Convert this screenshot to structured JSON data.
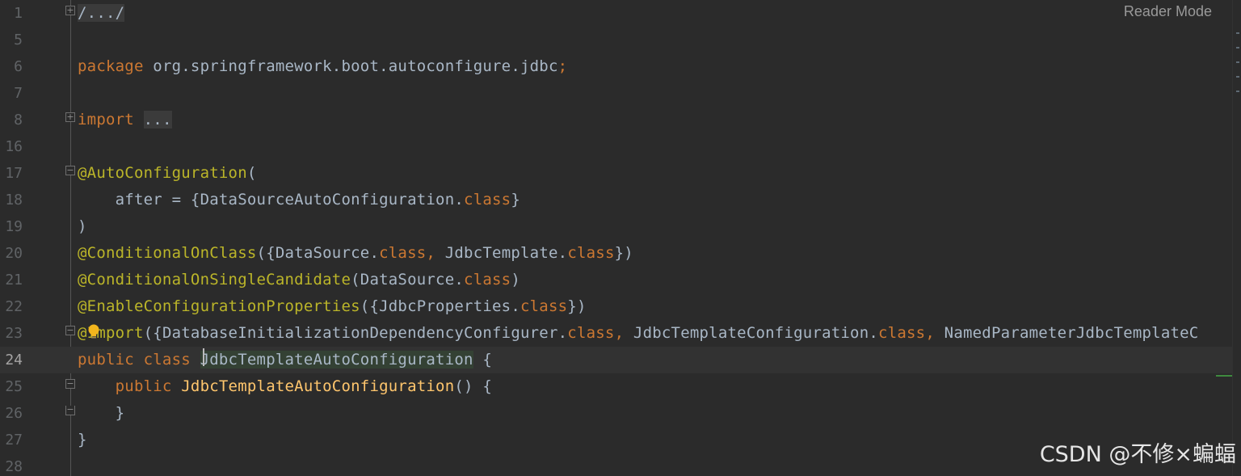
{
  "reader_mode_label": "Reader Mode",
  "watermark": "CSDN @不修×蝙蝠",
  "lines": [
    {
      "num": "1",
      "segments": [
        {
          "t": "/.../",
          "c": "collapsed"
        }
      ]
    },
    {
      "num": "5",
      "segments": []
    },
    {
      "num": "6",
      "segments": [
        {
          "t": "package",
          "c": "kw"
        },
        {
          "t": " org.springframework.boot.autoconfigure.jdbc",
          "c": ""
        },
        {
          "t": ";",
          "c": "kw"
        }
      ]
    },
    {
      "num": "7",
      "segments": []
    },
    {
      "num": "8",
      "segments": [
        {
          "t": "import",
          "c": "kw"
        },
        {
          "t": " ",
          "c": ""
        },
        {
          "t": "...",
          "c": "collapsed"
        }
      ]
    },
    {
      "num": "16",
      "segments": []
    },
    {
      "num": "17",
      "segments": [
        {
          "t": "@AutoConfiguration",
          "c": "ann"
        },
        {
          "t": "(",
          "c": ""
        }
      ]
    },
    {
      "num": "18",
      "segments": [
        {
          "t": "    after = {DataSourceAutoConfiguration.",
          "c": ""
        },
        {
          "t": "class",
          "c": "kw"
        },
        {
          "t": "}",
          "c": ""
        }
      ]
    },
    {
      "num": "19",
      "segments": [
        {
          "t": ")",
          "c": ""
        }
      ]
    },
    {
      "num": "20",
      "segments": [
        {
          "t": "@ConditionalOnClass",
          "c": "ann"
        },
        {
          "t": "({DataSource.",
          "c": ""
        },
        {
          "t": "class, ",
          "c": "kw"
        },
        {
          "t": "JdbcTemplate.",
          "c": ""
        },
        {
          "t": "class",
          "c": "kw"
        },
        {
          "t": "})",
          "c": ""
        }
      ]
    },
    {
      "num": "21",
      "segments": [
        {
          "t": "@ConditionalOnSingleCandidate",
          "c": "ann"
        },
        {
          "t": "(DataSource.",
          "c": ""
        },
        {
          "t": "class",
          "c": "kw"
        },
        {
          "t": ")",
          "c": ""
        }
      ]
    },
    {
      "num": "22",
      "segments": [
        {
          "t": "@EnableConfigurationProperties",
          "c": "ann"
        },
        {
          "t": "({JdbcProperties.",
          "c": ""
        },
        {
          "t": "class",
          "c": "kw"
        },
        {
          "t": "})",
          "c": ""
        }
      ]
    },
    {
      "num": "23",
      "segments": [
        {
          "t": "@Import",
          "c": "ann"
        },
        {
          "t": "({DatabaseInitializationDependencyConfigurer.",
          "c": ""
        },
        {
          "t": "class, ",
          "c": "kw"
        },
        {
          "t": "JdbcTemplateConfiguration.",
          "c": ""
        },
        {
          "t": "class, ",
          "c": "kw"
        },
        {
          "t": "NamedParameterJdbcTemplateC",
          "c": ""
        }
      ]
    },
    {
      "num": "24",
      "current": true,
      "segments": [
        {
          "t": "public class ",
          "c": "kw"
        },
        {
          "t": "JdbcTemplateAutoConfiguration",
          "c": "sel-word"
        },
        {
          "t": " {",
          "c": ""
        }
      ]
    },
    {
      "num": "25",
      "segments": [
        {
          "t": "    ",
          "c": ""
        },
        {
          "t": "public ",
          "c": "kw"
        },
        {
          "t": "JdbcTemplateAutoConfiguration",
          "c": "fn"
        },
        {
          "t": "() {",
          "c": ""
        }
      ]
    },
    {
      "num": "26",
      "segments": [
        {
          "t": "    }",
          "c": ""
        }
      ]
    },
    {
      "num": "27",
      "segments": [
        {
          "t": "}",
          "c": ""
        }
      ]
    },
    {
      "num": "28",
      "segments": []
    }
  ]
}
